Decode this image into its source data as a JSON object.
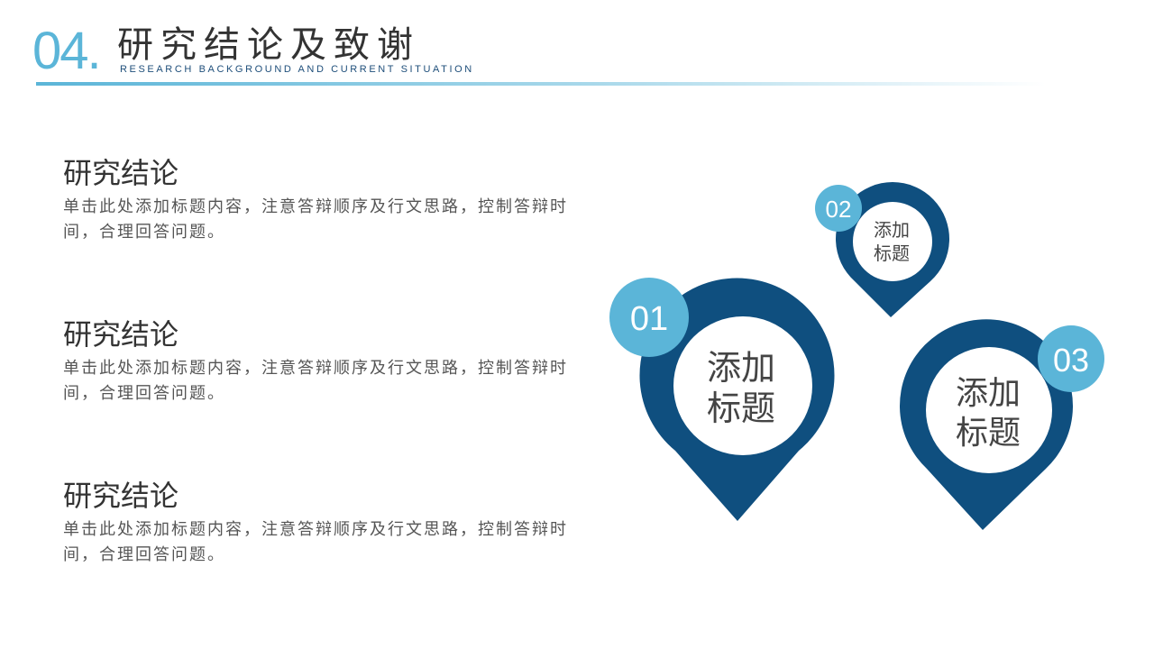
{
  "header": {
    "number": "04.",
    "title": "研究结论及致谢",
    "subtitle": "RESEARCH BACKGROUND AND CURRENT SITUATION"
  },
  "sections": [
    {
      "title": "研究结论",
      "body": "单击此处添加标题内容，注意答辩顺序及行文思路，控制答辩时间，合理回答问题。"
    },
    {
      "title": "研究结论",
      "body": "单击此处添加标题内容，注意答辩顺序及行文思路，控制答辩时间，合理回答问题。"
    },
    {
      "title": "研究结论",
      "body": "单击此处添加标题内容，注意答辩顺序及行文思路，控制答辩时间，合理回答问题。"
    }
  ],
  "pins": [
    {
      "number": "01",
      "line1": "添加",
      "line2": "标题"
    },
    {
      "number": "02",
      "line1": "添加",
      "line2": "标题"
    },
    {
      "number": "03",
      "line1": "添加",
      "line2": "标题"
    }
  ],
  "colors": {
    "accent": "#5bb5d8",
    "pin": "#0f4f7f",
    "text": "#333333"
  }
}
